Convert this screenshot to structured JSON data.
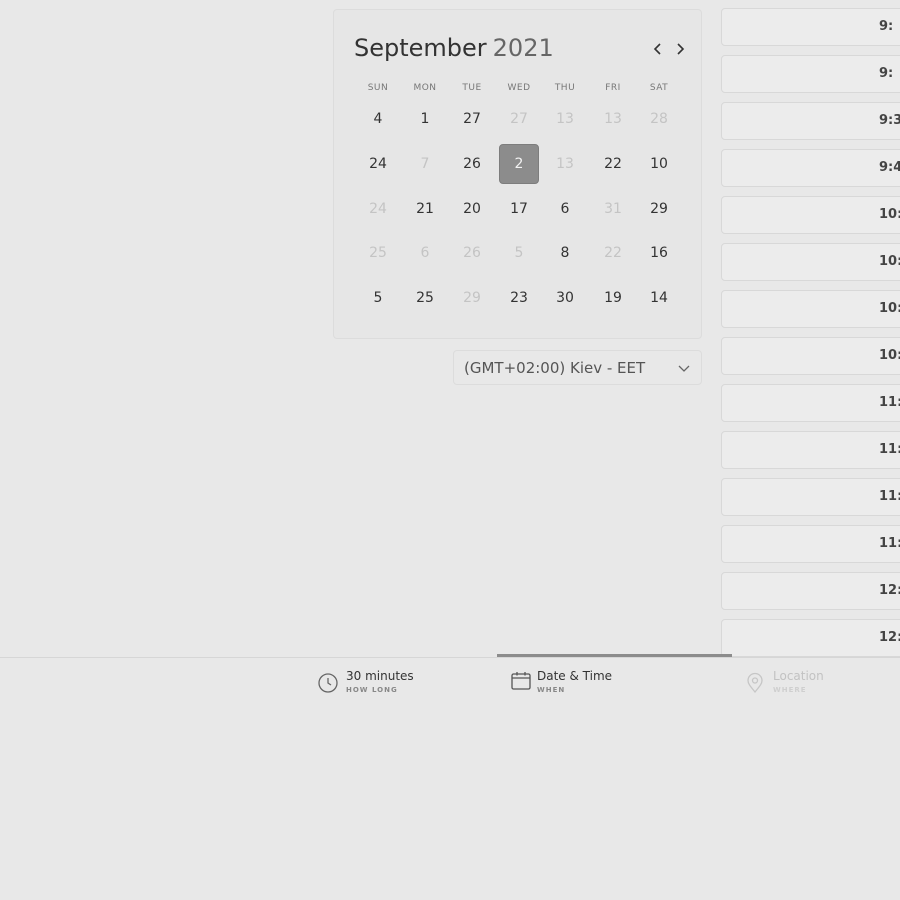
{
  "calendar": {
    "month": "September",
    "year": "2021",
    "weekdays": [
      "SUN",
      "MON",
      "TUE",
      "WED",
      "THU",
      "FRI",
      "SAT"
    ],
    "weeks": [
      [
        {
          "d": "4"
        },
        {
          "d": "1"
        },
        {
          "d": "27"
        },
        {
          "d": "27",
          "disabled": true
        },
        {
          "d": "13",
          "disabled": true
        },
        {
          "d": "13",
          "disabled": true
        },
        {
          "d": "28",
          "disabled": true
        }
      ],
      [
        {
          "d": "24"
        },
        {
          "d": "7",
          "disabled": true
        },
        {
          "d": "26"
        },
        {
          "d": "2",
          "selected": true
        },
        {
          "d": "13",
          "disabled": true
        },
        {
          "d": "22"
        },
        {
          "d": "10"
        }
      ],
      [
        {
          "d": "24",
          "disabled": true
        },
        {
          "d": "21"
        },
        {
          "d": "20"
        },
        {
          "d": "17"
        },
        {
          "d": "6"
        },
        {
          "d": "31",
          "disabled": true
        },
        {
          "d": "29"
        }
      ],
      [
        {
          "d": "25",
          "disabled": true
        },
        {
          "d": "6",
          "disabled": true
        },
        {
          "d": "26",
          "disabled": true
        },
        {
          "d": "5",
          "disabled": true
        },
        {
          "d": "8"
        },
        {
          "d": "22",
          "disabled": true
        },
        {
          "d": "16"
        }
      ],
      [
        {
          "d": "5"
        },
        {
          "d": "25"
        },
        {
          "d": "29",
          "disabled": true
        },
        {
          "d": "23"
        },
        {
          "d": "30"
        },
        {
          "d": "19"
        },
        {
          "d": "14"
        }
      ]
    ]
  },
  "timezone": "(GMT+02:00) Kiev - EET",
  "time_slots": [
    "9:",
    "9:",
    "9:3",
    "9:4",
    "10:",
    "10:",
    "10:",
    "10:",
    "11:",
    "11:",
    "11:",
    "11:",
    "12:",
    "12:"
  ],
  "steps": [
    {
      "label": "30 minutes",
      "sub": "HOW LONG"
    },
    {
      "label": "Date & Time",
      "sub": "WHEN"
    },
    {
      "label": "Location",
      "sub": "WHERE"
    }
  ]
}
